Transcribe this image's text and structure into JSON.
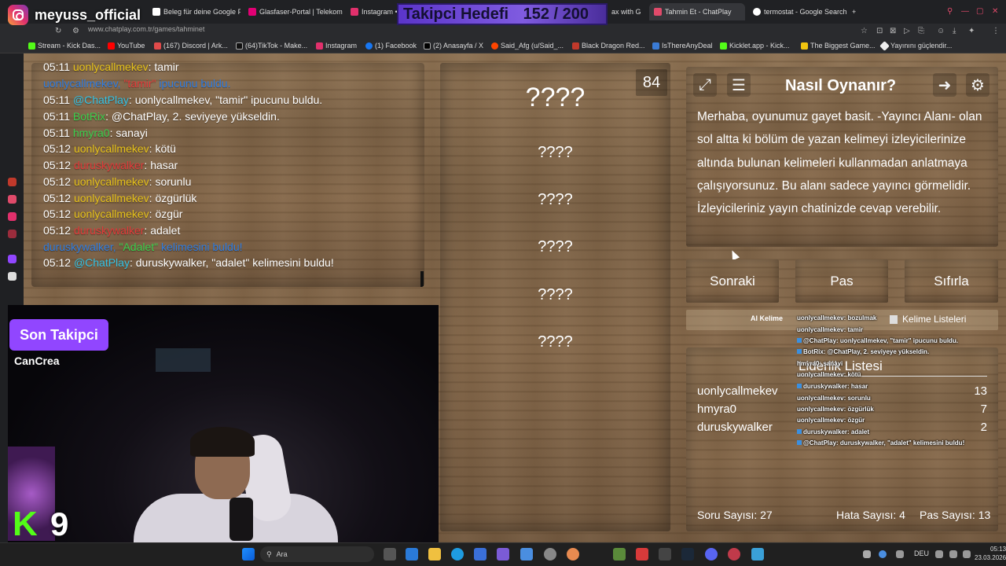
{
  "brand": {
    "name": "meyuss_official"
  },
  "follow_goal": {
    "label": "Takipci Hedefi",
    "value": "152 / 200",
    "current": 152,
    "target": 200,
    "color": "#7f5be0"
  },
  "tabs": [
    {
      "label": "Beleg für deine Google Pl...",
      "icon": "google-icon",
      "active": false
    },
    {
      "label": "Glasfaser-Portal | Telekom",
      "icon": "telekom-icon",
      "active": false
    },
    {
      "label": "Instagram •",
      "icon": "instagram-icon",
      "active": false
    },
    {
      "label": "ax with G",
      "icon": "tab-icon",
      "active": false
    },
    {
      "label": "Tahmin Et - ChatPlay",
      "icon": "chatplay-icon",
      "active": true
    },
    {
      "label": "termostat - Google Search",
      "icon": "google-icon",
      "active": false
    }
  ],
  "address": {
    "url": "www.chatplay.com.tr/games/tahminet"
  },
  "bookmarks": [
    {
      "label": "Stream - Kick Das...",
      "icon": "kick-icon"
    },
    {
      "label": "YouTube",
      "icon": "youtube-icon"
    },
    {
      "label": "(167) Discord | Ark...",
      "icon": "discord-icon"
    },
    {
      "label": "(64)TikTok - Make...",
      "icon": "tiktok-icon"
    },
    {
      "label": "Instagram",
      "icon": "instagram-icon"
    },
    {
      "label": "(1) Facebook",
      "icon": "facebook-icon"
    },
    {
      "label": "(2) Anasayfa / X",
      "icon": "x-icon"
    },
    {
      "label": "Said_Afg (u/Said_...",
      "icon": "reddit-icon"
    },
    {
      "label": "Black Dragon Red...",
      "icon": "bookmark-icon"
    },
    {
      "label": "IsThereAnyDeal",
      "icon": "bookmark-icon"
    },
    {
      "label": "Kicklet.app - Kick...",
      "icon": "kicklet-icon"
    },
    {
      "label": "The Biggest Game...",
      "icon": "bookmark-icon"
    },
    {
      "label": "Yayınını güçlendir...",
      "icon": "bookmark-icon"
    }
  ],
  "chat": [
    {
      "time": "05:11",
      "user": "uonlycallmekev",
      "user_color": "yellow",
      "sep": ": ",
      "text": "tamir"
    },
    {
      "time": "",
      "user": "uonlycallmekev,",
      "user_color": "blue",
      "sep": " ",
      "hl": "\"tamir\"",
      "text": " ipucunu buldu."
    },
    {
      "time": "05:11",
      "user": "@ChatPlay",
      "user_color": "cyan",
      "sep": ": ",
      "text": "uonlycallmekev, \"tamir\" ipucunu buldu."
    },
    {
      "time": "05:11",
      "user": "BotRix",
      "user_color": "green",
      "sep": ": ",
      "text": "@ChatPlay, 2. seviyeye yükseldin."
    },
    {
      "time": "05:11",
      "user": "hmyra0",
      "user_color": "green",
      "sep": ": ",
      "text": "sanayi"
    },
    {
      "time": "05:12",
      "user": "uonlycallmekev",
      "user_color": "yellow",
      "sep": ": ",
      "text": "kötü"
    },
    {
      "time": "05:12",
      "user": "duruskywalker",
      "user_color": "red",
      "sep": ": ",
      "text": "hasar"
    },
    {
      "time": "05:12",
      "user": "uonlycallmekev",
      "user_color": "yellow",
      "sep": ": ",
      "text": "sorunlu"
    },
    {
      "time": "05:12",
      "user": "uonlycallmekev",
      "user_color": "yellow",
      "sep": ": ",
      "text": "özgürlük"
    },
    {
      "time": "05:12",
      "user": "uonlycallmekev",
      "user_color": "yellow",
      "sep": ": ",
      "text": "özgür"
    },
    {
      "time": "05:12",
      "user": "duruskywalker",
      "user_color": "red",
      "sep": ": ",
      "text": "adalet"
    },
    {
      "time": "",
      "user": "duruskywalker,",
      "user_color": "blue",
      "sep": " ",
      "hl": "\"Adalet\"",
      "text": " kelimesini buldu!"
    },
    {
      "time": "05:12",
      "user": "@ChatPlay",
      "user_color": "cyan",
      "sep": ": ",
      "text": "duruskywalker, \"adalet\" kelimesini buldu!"
    }
  ],
  "questions": [
    "????",
    "????",
    "????",
    "????",
    "????",
    "????"
  ],
  "counter": "84",
  "howto": {
    "title": "Nasıl Oynanır?",
    "text": "Merhaba, oyunumuz gayet basit. -Yayıncı Alanı- olan sol altta ki bölüm de yazan kelimeyi izleyicilerinize altında bulunan kelimeleri kullanmadan anlatmaya çalışıyorsunuz. Bu alanı sadece yayıncı görmelidir. İzleyicileriniz yayın chatinizde cevap verebilir."
  },
  "buttons": {
    "next": "Sonraki",
    "pass": "Pas",
    "reset": "Sıfırla"
  },
  "word_toolbar": {
    "ai": "AI Kelime",
    "lists": "Kelime Listeleri"
  },
  "leaderboard": {
    "title": "Liderlik Listesi",
    "rows": [
      {
        "name": "uonlycallmekev",
        "score": "13"
      },
      {
        "name": "hmyra0",
        "score": "7"
      },
      {
        "name": "duruskywalker",
        "score": "2"
      }
    ]
  },
  "stats": {
    "questions": "Soru Sayısı: 27",
    "errors": "Hata Sayısı: 4",
    "passes": "Pas Sayısı: 13"
  },
  "overlay_chat": [
    "uonlycallmekev: bozulmak",
    "uonlycallmekev: tamir",
    "@ChatPlay: uonlycallmekev, \"tamir\" ipucunu buldu.",
    "BotRix: @ChatPlay, 2. seviyeye yükseldin.",
    "hmyra0: sanayi",
    "uonlycallmekev: kötü",
    "duruskywalker: hasar",
    "uonlycallmekev: sorunlu",
    "uonlycallmekev: özgürlük",
    "uonlycallmekev: özgür",
    "duruskywalker: adalet",
    "@ChatPlay: duruskywalker, \"adalet\" kelimesini buldu!"
  ],
  "stream": {
    "last_follower_label": "Son Takipci",
    "last_follower": "CanCrea",
    "kick_logo": "K",
    "kick_count": "9"
  },
  "taskbar": {
    "search_placeholder": "Ara",
    "lang": "DEU",
    "time": "05:13",
    "date": "23.03.2026"
  }
}
